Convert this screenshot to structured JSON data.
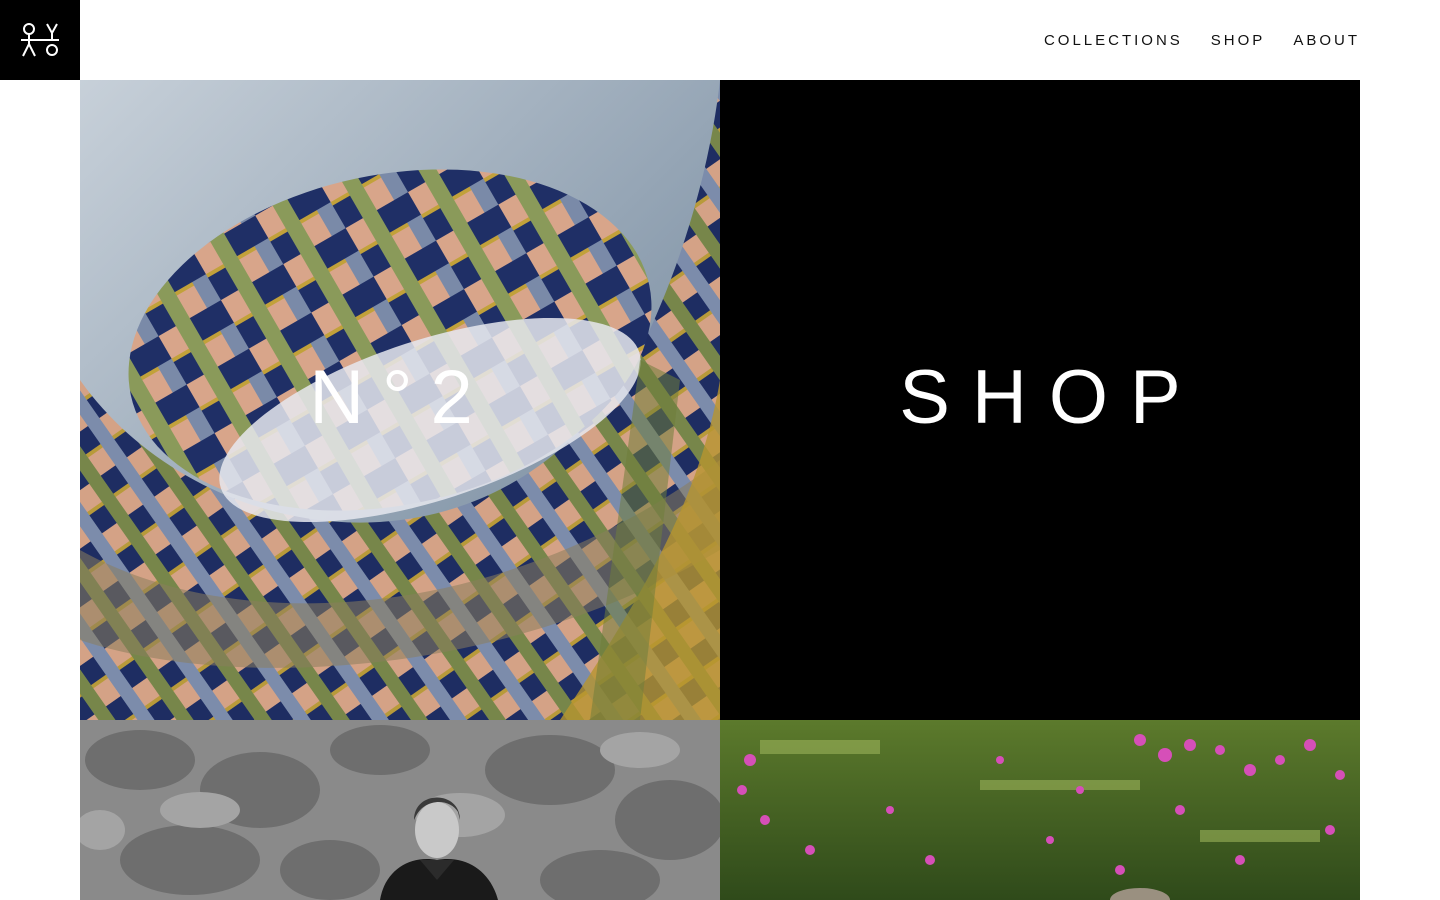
{
  "brand": {
    "logo_icon": "figures-logo-icon",
    "background": "#000000"
  },
  "nav": {
    "items": [
      {
        "label": "COLLECTIONS"
      },
      {
        "label": "SHOP"
      },
      {
        "label": "ABOUT"
      }
    ]
  },
  "tiles": {
    "collection": {
      "title": "N°2",
      "image": "woven-textile-photo"
    },
    "shop": {
      "title": "SHOP",
      "background": "#000000"
    },
    "portrait": {
      "image": "portrait-stone-wall-photo"
    },
    "meadow": {
      "image": "meadow-pink-flowers-photo"
    }
  }
}
